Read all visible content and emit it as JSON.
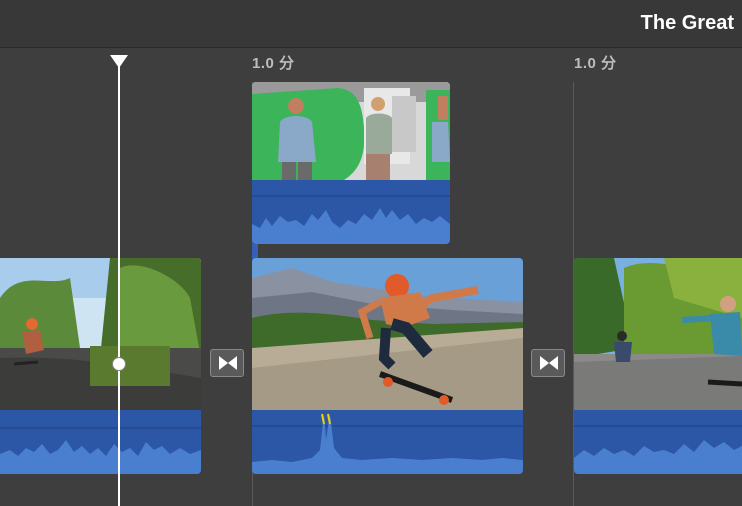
{
  "header": {
    "title": "The Great"
  },
  "ruler": {
    "labels": [
      "1.0 分",
      "1.0 分"
    ]
  },
  "clips": {
    "connected": {
      "name": "green-screen-clip"
    },
    "main": [
      {
        "name": "skate-forest-clip"
      },
      {
        "name": "skate-jump-clip"
      },
      {
        "name": "skate-road-clip"
      }
    ]
  },
  "icons": {
    "transition": "bowtie-transition-icon",
    "playhead": "playhead-icon"
  },
  "colors": {
    "audio_wave": "#2c57a6",
    "wave_fill": "#4a7fd0",
    "background": "#3e3e3e",
    "clip_peak": "#f5d000"
  }
}
